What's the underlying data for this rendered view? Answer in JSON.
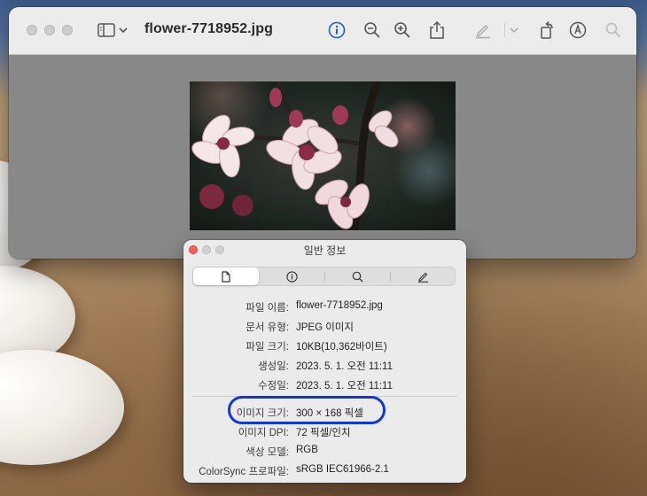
{
  "window": {
    "title": "flower-7718952.jpg",
    "toolbar_icons": [
      "sidebar-icon",
      "chevron-down-icon",
      "info-icon",
      "zoom-out-icon",
      "zoom-in-icon",
      "share-icon",
      "markup-pen-icon",
      "chevron-down-icon",
      "rotate-icon",
      "annotate-icon",
      "search-icon"
    ]
  },
  "info_panel": {
    "title": "일반 정보",
    "tabs": [
      "document-icon",
      "info-icon",
      "search-icon",
      "pen-icon"
    ],
    "rows": [
      {
        "label": "파일 이름:",
        "value": "flower-7718952.jpg"
      },
      {
        "label": "문서 유형:",
        "value": "JPEG 이미지"
      },
      {
        "label": "파일 크기:",
        "value": "10KB(10,362바이트)"
      },
      {
        "label": "생성일:",
        "value": "2023. 5. 1. 오전 11:11"
      },
      {
        "label": "수정일:",
        "value": "2023. 5. 1. 오전 11:11"
      },
      {
        "label": "이미지 크기:",
        "value": "300 × 168 픽셀"
      },
      {
        "label": "이미지 DPI:",
        "value": "72 픽셀/인치"
      },
      {
        "label": "색상 모델:",
        "value": "RGB"
      },
      {
        "label": "ColorSync 프로파일:",
        "value": "sRGB IEC61966-2.1"
      }
    ]
  },
  "colors": {
    "highlight": "#1038d8",
    "info_icon_active": "#1a5fd6",
    "close_red": "#fe5f57"
  }
}
